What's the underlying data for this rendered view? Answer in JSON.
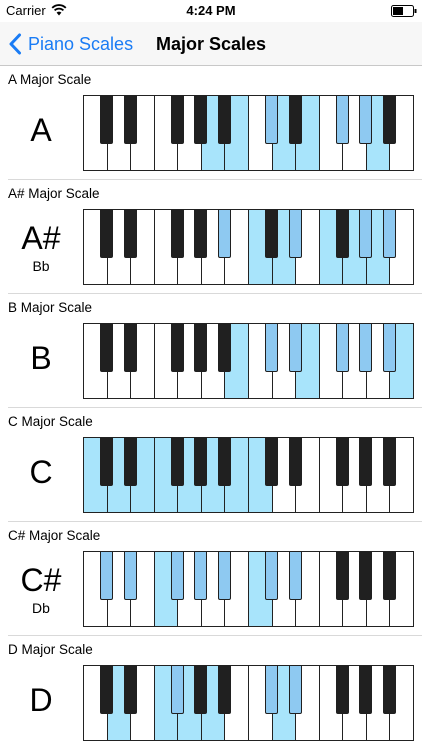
{
  "status_bar": {
    "carrier": "Carrier",
    "time": "4:24 PM"
  },
  "nav": {
    "back_label": "Piano Scales",
    "title": "Major Scales"
  },
  "scales": [
    {
      "title": "A Major Scale",
      "key": "A",
      "alt": "",
      "white_on": [
        5,
        6,
        8,
        9,
        12
      ],
      "black_on": [
        5,
        7,
        8,
        10
      ]
    },
    {
      "title": "A# Major Scale",
      "key": "A#",
      "alt": "Bb",
      "white_on": [
        7,
        8,
        10,
        11,
        12
      ],
      "black_on": [
        4,
        6,
        8,
        9
      ]
    },
    {
      "title": "B Major Scale",
      "key": "B",
      "alt": "",
      "white_on": [
        6,
        9,
        13
      ],
      "black_on": [
        5,
        6,
        7,
        8,
        9
      ]
    },
    {
      "title": "C Major Scale",
      "key": "C",
      "alt": "",
      "white_on": [
        0,
        1,
        2,
        3,
        4,
        5,
        6,
        7
      ],
      "black_on": []
    },
    {
      "title": "C# Major Scale",
      "key": "C#",
      "alt": "Db",
      "white_on": [
        3,
        7
      ],
      "black_on": [
        0,
        1,
        2,
        3,
        4,
        5,
        6
      ]
    },
    {
      "title": "D Major Scale",
      "key": "D",
      "alt": "",
      "white_on": [
        1,
        3,
        4,
        5,
        8
      ],
      "black_on": [
        2,
        5,
        6
      ]
    }
  ],
  "colors": {
    "highlight": "#a8e4fb",
    "black_highlight": "#8ec9f1",
    "accent": "#1a7cf5"
  }
}
